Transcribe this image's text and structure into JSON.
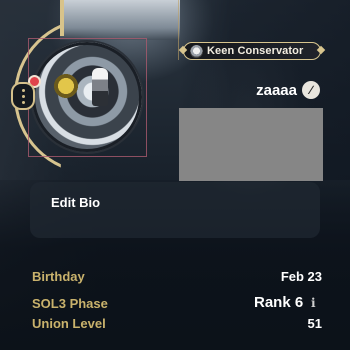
{
  "profile": {
    "title_badge": "Keen Conservator",
    "player_name": "zaaaa",
    "bio_button": "Edit Bio"
  },
  "stats": {
    "birthday_label": "Birthday",
    "birthday_value": "Feb 23",
    "phase_label": "SOL3 Phase",
    "phase_value": "Rank 6",
    "union_label": "Union Level",
    "union_value": "51"
  },
  "icons": {
    "more": "more-options-icon",
    "edit": "edit-pencil-icon",
    "info": "info-icon",
    "badge": "title-badge-icon"
  },
  "colors": {
    "gold_accent": "#d7c48f",
    "stat_label": "#c9b26c",
    "notification": "#e0434b"
  }
}
